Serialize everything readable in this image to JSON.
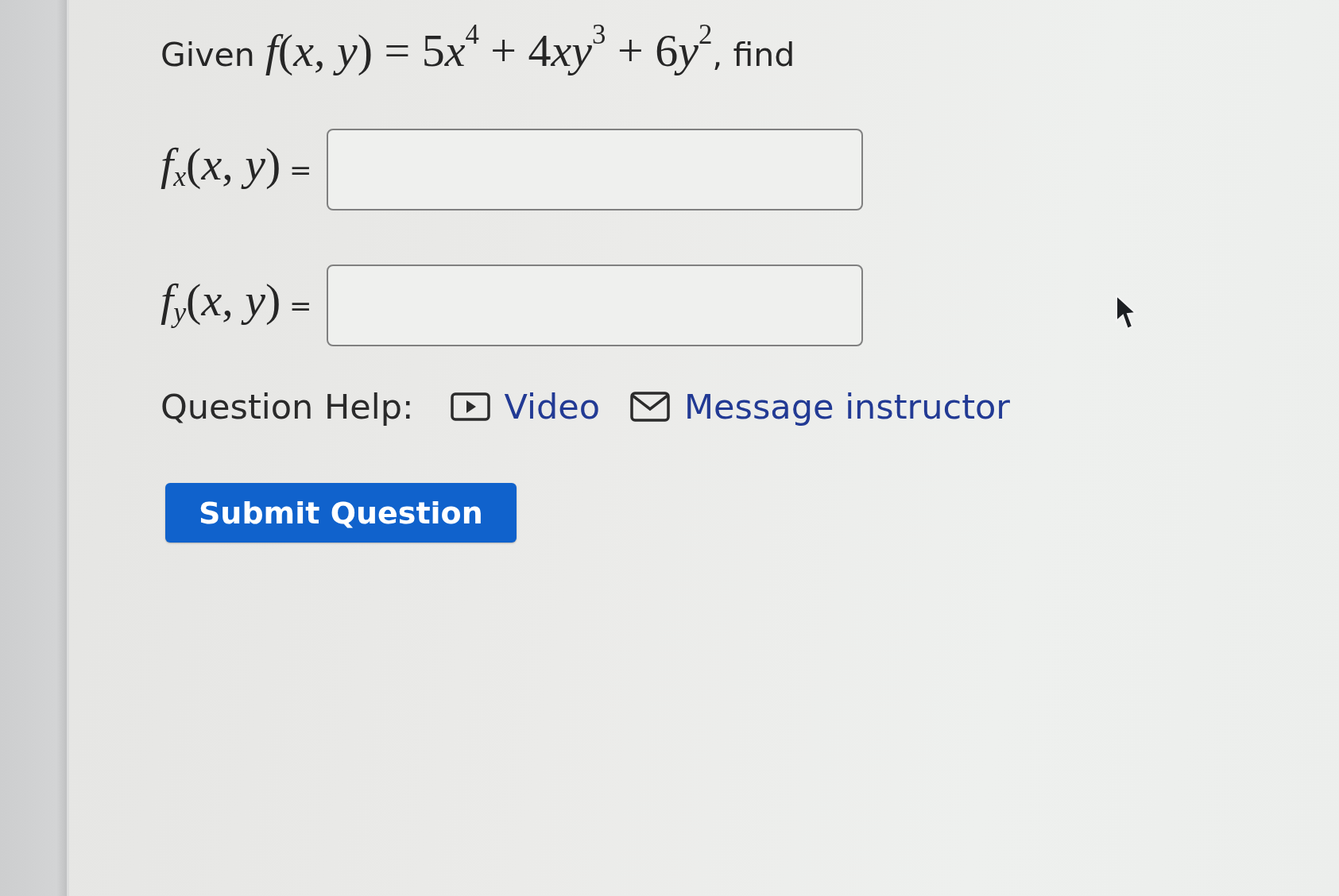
{
  "question": {
    "prompt": [
      {
        "kind": "text",
        "text": "Given "
      },
      {
        "kind": "math",
        "text": "*f*(*x*, *y*) = 5"
      },
      {
        "kind": "math",
        "text": "*x*$^{4}$ + 4"
      },
      {
        "kind": "math",
        "text": "*xy*$^{3}$ + 6"
      },
      {
        "kind": "math",
        "text": "*y*$^{2}$"
      },
      {
        "kind": "text",
        "text": ", find"
      }
    ]
  },
  "answers": [
    {
      "label": [
        {
          "kind": "math",
          "text": "*f*$_{x}$(*x*, *y*)"
        },
        {
          "kind": "text",
          "text": " ="
        }
      ]
    },
    {
      "label": [
        {
          "kind": "math",
          "text": "*f*$_{y}$(*x*, *y*)"
        },
        {
          "kind": "text",
          "text": " ="
        }
      ]
    }
  ],
  "help": {
    "label": "Question Help:",
    "links": [
      {
        "kind": "video",
        "text": "Video"
      },
      {
        "kind": "message",
        "text": "Message instructor"
      }
    ]
  },
  "submit": {
    "label": "Submit Question"
  }
}
